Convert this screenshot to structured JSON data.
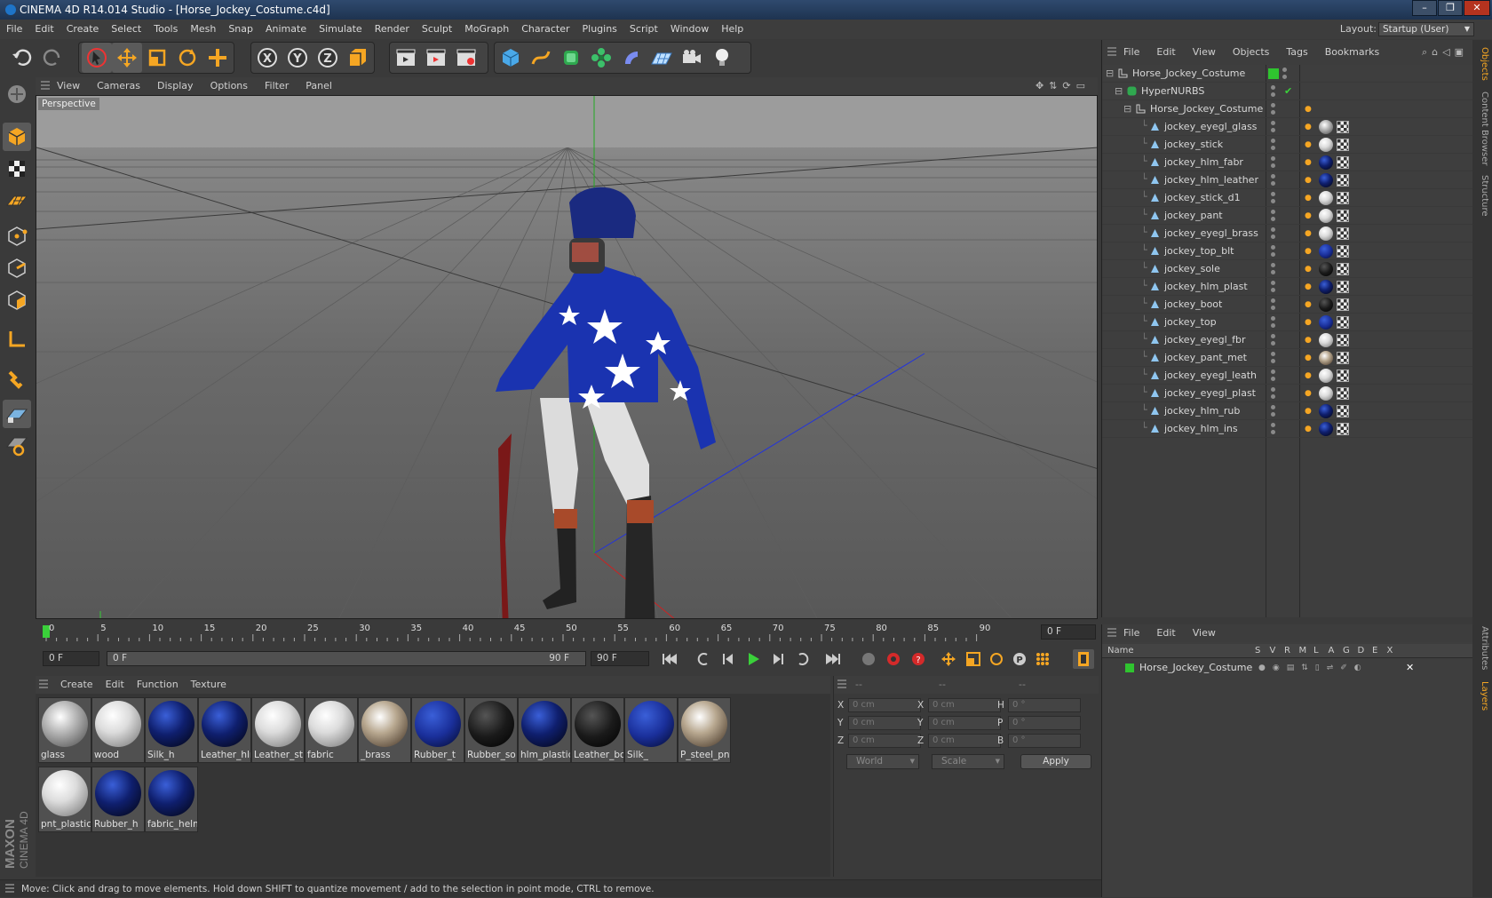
{
  "window": {
    "title": "CINEMA 4D R14.014 Studio - [Horse_Jockey_Costume.c4d]",
    "buttons": [
      "–",
      "❐",
      "✕"
    ]
  },
  "menubar": [
    "File",
    "Edit",
    "Create",
    "Select",
    "Tools",
    "Mesh",
    "Snap",
    "Animate",
    "Simulate",
    "Render",
    "Sculpt",
    "MoGraph",
    "Character",
    "Plugins",
    "Script",
    "Window",
    "Help"
  ],
  "layout": {
    "label": "Layout:",
    "value": "Startup (User)"
  },
  "viewport": {
    "menu": [
      "View",
      "Cameras",
      "Display",
      "Options",
      "Filter",
      "Panel"
    ],
    "label": "Perspective"
  },
  "timeline": {
    "ticks": [
      "0",
      "5",
      "10",
      "15",
      "20",
      "25",
      "30",
      "35",
      "40",
      "45",
      "50",
      "55",
      "60",
      "65",
      "70",
      "75",
      "80",
      "85",
      "90"
    ],
    "current_frame": "0 F",
    "start_field": "0 F",
    "range_start": "0 F",
    "range_end": "90 F",
    "end_field": "90 F"
  },
  "materials": {
    "menu": [
      "Create",
      "Edit",
      "Function",
      "Texture"
    ],
    "items": [
      {
        "label": "glass",
        "style": "glass"
      },
      {
        "label": "wood",
        "style": "white"
      },
      {
        "label": "Silk_h",
        "style": "navy"
      },
      {
        "label": "Leather_hlm",
        "style": "navy"
      },
      {
        "label": "Leather_st",
        "style": "white"
      },
      {
        "label": "fabric",
        "style": "white"
      },
      {
        "label": "_brass",
        "style": "chrome"
      },
      {
        "label": "Rubber_t",
        "style": "stars"
      },
      {
        "label": "Rubber_so",
        "style": "dark"
      },
      {
        "label": "hlm_plastic",
        "style": "navy"
      },
      {
        "label": "Leather_bo",
        "style": "dark"
      },
      {
        "label": "Silk_",
        "style": "stars"
      },
      {
        "label": "P_steel_pnt",
        "style": "chrome"
      },
      {
        "label": "pnt_plastic",
        "style": "white"
      },
      {
        "label": "Rubber_h",
        "style": "navy"
      },
      {
        "label": "fabric_helm",
        "style": "navy"
      }
    ]
  },
  "coordinates": {
    "header": [
      "--",
      "--",
      "--"
    ],
    "rows": [
      {
        "a": "X",
        "av": "0 cm",
        "b": "X",
        "bv": "0 cm",
        "c": "H",
        "cv": "0 °"
      },
      {
        "a": "Y",
        "av": "0 cm",
        "b": "Y",
        "bv": "0 cm",
        "c": "P",
        "cv": "0 °"
      },
      {
        "a": "Z",
        "av": "0 cm",
        "b": "Z",
        "bv": "0 cm",
        "c": "B",
        "cv": "0 °"
      }
    ],
    "mode1": "World",
    "mode2": "Scale",
    "apply": "Apply"
  },
  "status": "Move: Click and drag to move elements. Hold down SHIFT to quantize movement / add to the selection in point mode, CTRL to remove.",
  "objects": {
    "menu": [
      "File",
      "Edit",
      "View",
      "Objects",
      "Tags",
      "Bookmarks"
    ],
    "root": "Horse_Jockey_Costume",
    "nurbs": "HyperNURBS",
    "group": "Horse_Jockey_Costume",
    "items": [
      {
        "name": "jockey_eyegl_glass",
        "tag": "glass"
      },
      {
        "name": "jockey_stick",
        "tag": "white"
      },
      {
        "name": "jockey_hlm_fabr",
        "tag": "navy"
      },
      {
        "name": "jockey_hlm_leather",
        "tag": "navy"
      },
      {
        "name": "jockey_stick_d1",
        "tag": "white"
      },
      {
        "name": "jockey_pant",
        "tag": "white"
      },
      {
        "name": "jockey_eyegl_brass",
        "tag": "white"
      },
      {
        "name": "jockey_top_blt",
        "tag": "stars"
      },
      {
        "name": "jockey_sole",
        "tag": "dark"
      },
      {
        "name": "jockey_hlm_plast",
        "tag": "navy"
      },
      {
        "name": "jockey_boot",
        "tag": "dark"
      },
      {
        "name": "jockey_top",
        "tag": "stars"
      },
      {
        "name": "jockey_eyegl_fbr",
        "tag": "white"
      },
      {
        "name": "jockey_pant_met",
        "tag": "chrome"
      },
      {
        "name": "jockey_eyegl_leath",
        "tag": "white"
      },
      {
        "name": "jockey_eyegl_plast",
        "tag": "white"
      },
      {
        "name": "jockey_hlm_rub",
        "tag": "navy"
      },
      {
        "name": "jockey_hlm_ins",
        "tag": "navy"
      }
    ]
  },
  "layers": {
    "menu": [
      "File",
      "Edit",
      "View"
    ],
    "columns": [
      "Name",
      "S",
      "V",
      "R",
      "M",
      "L",
      "A",
      "G",
      "D",
      "E",
      "X"
    ],
    "rows": [
      {
        "name": "Horse_Jockey_Costume"
      }
    ]
  },
  "right_tabs": [
    "Objects",
    "Content Browser",
    "Structure",
    "Attributes",
    "Layers"
  ],
  "brand": {
    "line1": "MAXON",
    "line2": "CINEMA 4D"
  },
  "colors": {
    "accent_blue": "#1f5fb8",
    "layer_green": "#2fc42f",
    "play_green": "#3ad03a"
  }
}
